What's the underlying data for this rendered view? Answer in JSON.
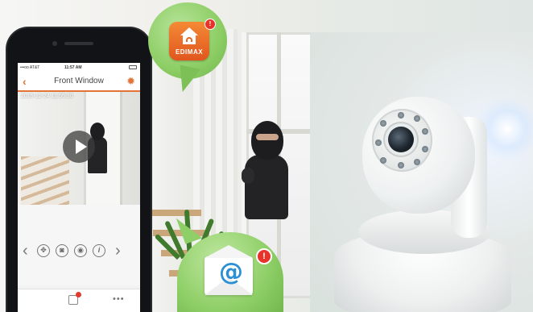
{
  "phone": {
    "status": {
      "carrier": "•••oo AT&T",
      "time": "11:57 AM"
    },
    "nav": {
      "back_icon": "chevron-left-icon",
      "title": "Front Window",
      "settings_icon": "gear-icon"
    },
    "video": {
      "timestamp": "2015-12-24  11:55:30",
      "play_icon": "play-icon"
    },
    "controls": [
      {
        "icon": "chevron-left-icon",
        "glyph": "‹"
      },
      {
        "icon": "pan-tilt-icon",
        "glyph": "✥"
      },
      {
        "icon": "snapshot-camera-icon",
        "glyph": "◙"
      },
      {
        "icon": "record-icon",
        "glyph": "◉"
      },
      {
        "icon": "info-icon",
        "glyph": "i"
      },
      {
        "icon": "chevron-right-icon",
        "glyph": "›"
      }
    ],
    "tabbar": {
      "calendar_icon": "calendar-icon",
      "more": "•••"
    }
  },
  "notification_app": {
    "label": "EDIMAX",
    "badge": "!"
  },
  "email_notification": {
    "symbol": "@",
    "badge": "!"
  },
  "colors": {
    "accent": "#e37336",
    "bubble": "#8ccd64",
    "badge": "#e8332a",
    "email_blue": "#2a8fd4"
  }
}
